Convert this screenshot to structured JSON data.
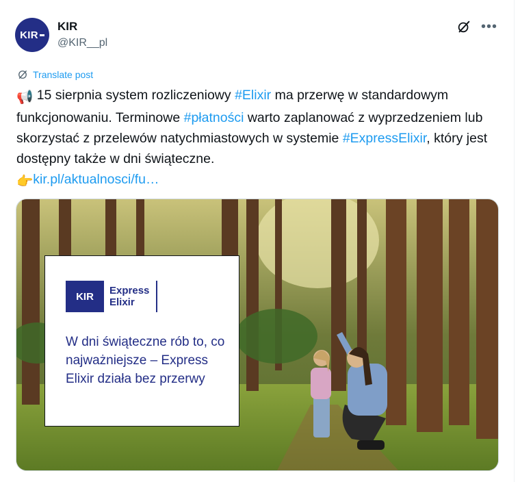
{
  "author": {
    "avatar_text": "KIR",
    "name": "KIR",
    "handle": "@KIR__pl"
  },
  "icons": {
    "grok": "grok-icon",
    "more": "more-icon",
    "translate": "translate-icon",
    "megaphone": "megaphone-icon",
    "pointing": "pointing-hand-icon"
  },
  "translate_label": "Translate post",
  "post": {
    "megaphone_emoji": "📢",
    "part1": " 15 sierpnia system rozliczeniowy ",
    "hashtag1": "#Elixir",
    "part2": " ma przerwę w standardowym funkcjonowaniu. Terminowe ",
    "hashtag2": "#płatności",
    "part3": " warto zaplanować z wyprzedzeniem lub skorzystać z przelewów natychmiastowych w systemie ",
    "hashtag3": "#ExpressElixir",
    "part4": ", który jest dostępny także w dni świąteczne.",
    "pointing_emoji": "👉",
    "link": "kir.pl/aktualnosci/fu…"
  },
  "media": {
    "logo_text": "KIR",
    "logo_title_line1": "Express",
    "logo_title_line2": "Elixir",
    "caption": "W dni świąteczne rób to, co najważniejsze – Express Elixir działa bez przerwy"
  },
  "colors": {
    "brand_navy": "#232e86",
    "link_blue": "#1d9bf0",
    "text_dark": "#0f1419",
    "text_gray": "#536471"
  }
}
